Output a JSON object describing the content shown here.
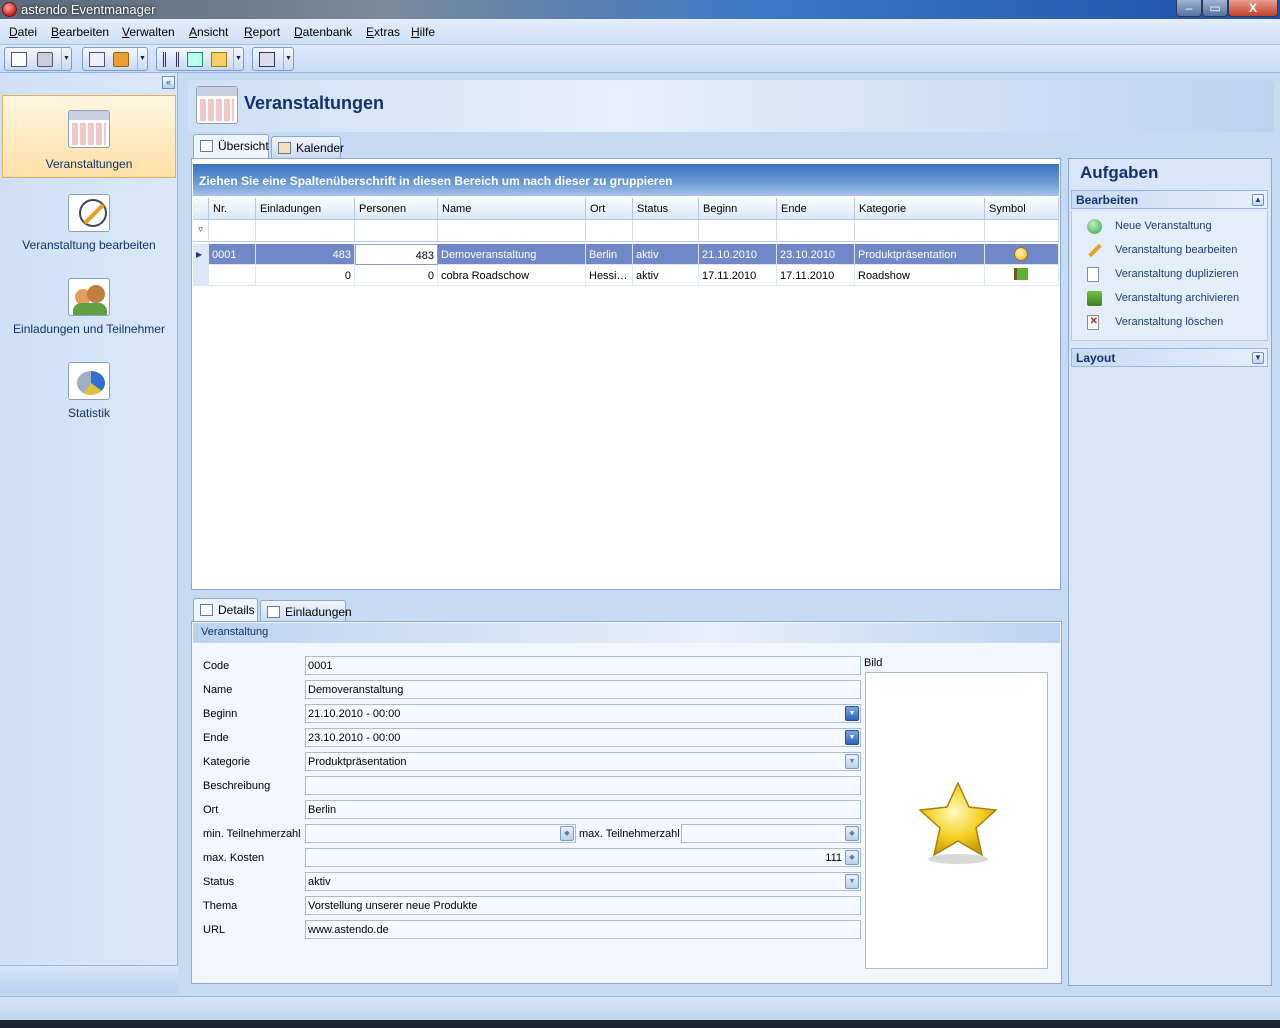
{
  "window": {
    "title": "astendo Eventmanager",
    "min": "‒",
    "max": "▭",
    "close": "X"
  },
  "menu": [
    {
      "underline": "D",
      "rest": "atei"
    },
    {
      "underline": "B",
      "rest": "earbeiten"
    },
    {
      "underline": "V",
      "rest": "erwalten"
    },
    {
      "underline": "A",
      "rest": "nsicht"
    },
    {
      "underline": "R",
      "rest": "eport"
    },
    {
      "underline": "D",
      "rest": "atenbank"
    },
    {
      "underline": "E",
      "rest": "xtras"
    },
    {
      "underline": "H",
      "rest": "ilfe"
    }
  ],
  "nav": {
    "collapse": "«",
    "items": [
      {
        "label": "Veranstaltungen"
      },
      {
        "label": "Veranstaltung bearbeiten"
      },
      {
        "label": "Einladungen und Teilnehmer"
      },
      {
        "label": "Statistik"
      }
    ]
  },
  "page": {
    "title": "Veranstaltungen"
  },
  "tabs": {
    "overview": "Übersicht",
    "calendar": "Kalender"
  },
  "grid": {
    "group_hint": "Ziehen Sie eine Spaltenüberschrift in diesen Bereich um nach dieser zu gruppieren",
    "columns": [
      "Nr.",
      "Einladungen",
      "Personen",
      "Name",
      "Ort",
      "Status",
      "Beginn",
      "Ende",
      "Kategorie",
      "Symbol"
    ],
    "rows": [
      {
        "nr": "0001",
        "einladungen": "483",
        "personen": "483",
        "name": "Demoveranstaltung",
        "ort": "Berlin",
        "status": "aktiv",
        "beginn": "21.10.2010",
        "ende": "23.10.2010",
        "kategorie": "Produktpräsentation",
        "symbol": "smiley-icon"
      },
      {
        "nr": "",
        "einladungen": "0",
        "personen": "0",
        "name": "cobra Roadschow",
        "ort": "Hessi…",
        "status": "aktiv",
        "beginn": "17.11.2010",
        "ende": "17.11.2010",
        "kategorie": "Roadshow",
        "symbol": "flag-icon"
      }
    ]
  },
  "tasks": {
    "title": "Aufgaben",
    "section_edit": "Bearbeiten",
    "section_layout": "Layout",
    "items": [
      {
        "label": "Neue Veranstaltung"
      },
      {
        "label": "Veranstaltung bearbeiten"
      },
      {
        "label": "Veranstaltung duplizieren"
      },
      {
        "label": "Veranstaltung archivieren"
      },
      {
        "label": "Veranstaltung löschen"
      }
    ]
  },
  "details_tabs": {
    "details": "Details",
    "invitations": "Einladungen"
  },
  "details": {
    "section": "Veranstaltung",
    "labels": {
      "code": "Code",
      "name": "Name",
      "beginn": "Beginn",
      "ende": "Ende",
      "kategorie": "Kategorie",
      "beschreibung": "Beschreibung",
      "ort": "Ort",
      "min_teilnehmer": "min. Teilnehmerzahl",
      "max_teilnehmer": "max. Teilnehmerzahl",
      "max_kosten": "max. Kosten",
      "status": "Status",
      "thema": "Thema",
      "url": "URL",
      "bild": "Bild"
    },
    "values": {
      "code": "0001",
      "name": "Demoveranstaltung",
      "beginn": "21.10.2010 - 00:00",
      "ende": "23.10.2010 - 00:00",
      "kategorie": "Produktpräsentation",
      "beschreibung": "",
      "ort": "Berlin",
      "min_teilnehmer": "",
      "max_teilnehmer": "",
      "max_kosten": "111",
      "status": "aktiv",
      "thema": "Vorstellung unserer neue Produkte",
      "url": "www.astendo.de"
    },
    "image_icon": "star-icon"
  },
  "colors": {
    "accent": "#14306e",
    "selection": "#7088c8",
    "header_blue": "#3a70c0"
  }
}
